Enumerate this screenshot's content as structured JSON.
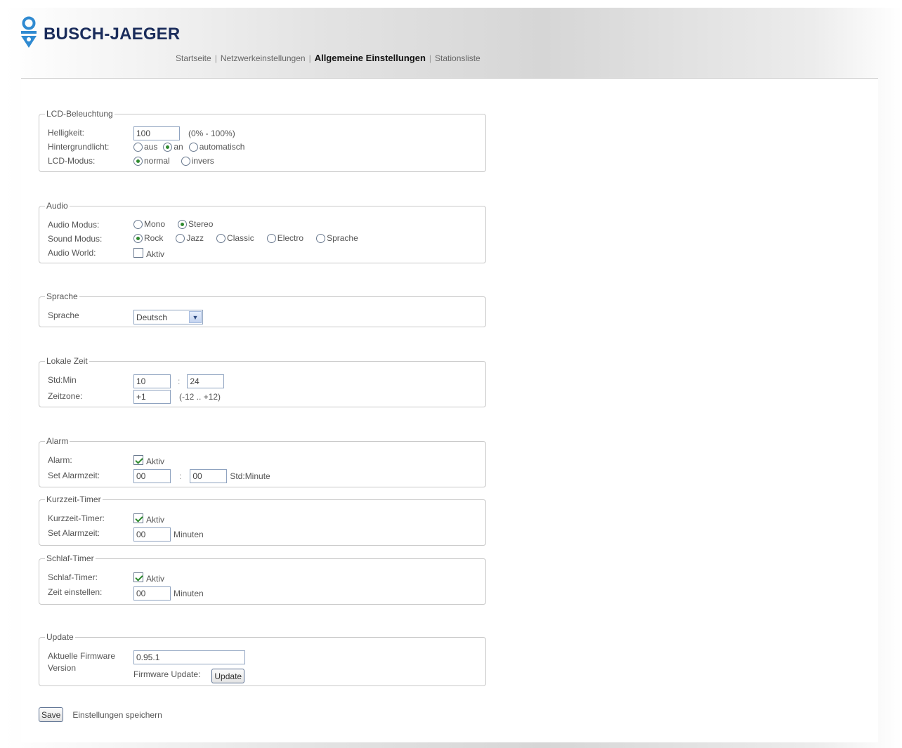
{
  "brand": {
    "name": "BUSCH-JAEGER",
    "color": "#1a2c5b",
    "logo_color": "#2f8ad1"
  },
  "nav": {
    "items": [
      {
        "label": "Startseite",
        "active": false
      },
      {
        "label": "Netzwerkeinstellungen",
        "active": false
      },
      {
        "label": "Allgemeine Einstellungen",
        "active": true
      },
      {
        "label": "Stationsliste",
        "active": false
      }
    ],
    "separator": "|"
  },
  "lcd": {
    "legend": "LCD-Beleuchtung",
    "helligkeit_label": "Helligkeit:",
    "helligkeit_value": "100",
    "helligkeit_hint": "(0% - 100%)",
    "hintergrund_label": "Hintergrundlicht:",
    "hintergrund_options": [
      "aus",
      "an",
      "automatisch"
    ],
    "hintergrund_selected": "an",
    "modus_label": "LCD-Modus:",
    "modus_options": [
      "normal",
      "invers"
    ],
    "modus_selected": "normal"
  },
  "audio": {
    "legend": "Audio",
    "modus_label": "Audio Modus:",
    "modus_options": [
      "Mono",
      "Stereo"
    ],
    "modus_selected": "Stereo",
    "sound_label": "Sound Modus:",
    "sound_options": [
      "Rock",
      "Jazz",
      "Classic",
      "Electro",
      "Sprache"
    ],
    "sound_selected": "Rock",
    "world_label": "Audio World:",
    "world_check_label": "Aktiv",
    "world_checked": false
  },
  "sprache": {
    "legend": "Sprache",
    "label": "Sprache",
    "selected": "Deutsch"
  },
  "zeit": {
    "legend": "Lokale Zeit",
    "stdmin_label": "Std:Min",
    "hour": "10",
    "colon": ":",
    "minute": "24",
    "zeitzone_label": "Zeitzone:",
    "zeitzone_value": "+1",
    "zeitzone_hint": "(-12 .. +12)"
  },
  "alarm": {
    "legend": "Alarm",
    "alarm_label": "Alarm:",
    "check_label": "Aktiv",
    "checked": true,
    "set_label": "Set Alarmzeit:",
    "hour": "00",
    "colon": ":",
    "minute": "00",
    "unit": "Std:Minute"
  },
  "kurzzeit": {
    "legend": "Kurzzeit-Timer",
    "timer_label": "Kurzzeit-Timer:",
    "check_label": "Aktiv",
    "checked": true,
    "set_label": "Set Alarmzeit:",
    "value": "00",
    "unit": "Minuten"
  },
  "schlaf": {
    "legend": "Schlaf-Timer",
    "timer_label": "Schlaf-Timer:",
    "check_label": "Aktiv",
    "checked": true,
    "set_label": "Zeit einstellen:",
    "value": "00",
    "unit": "Minuten"
  },
  "update": {
    "legend": "Update",
    "firmware_label_1": "Aktuelle Firmware",
    "firmware_label_2": "Version",
    "firmware_value": "0.95.1",
    "update_label": "Firmware Update:",
    "update_button": "Update"
  },
  "save": {
    "button": "Save",
    "text": "Einstellungen speichern"
  }
}
